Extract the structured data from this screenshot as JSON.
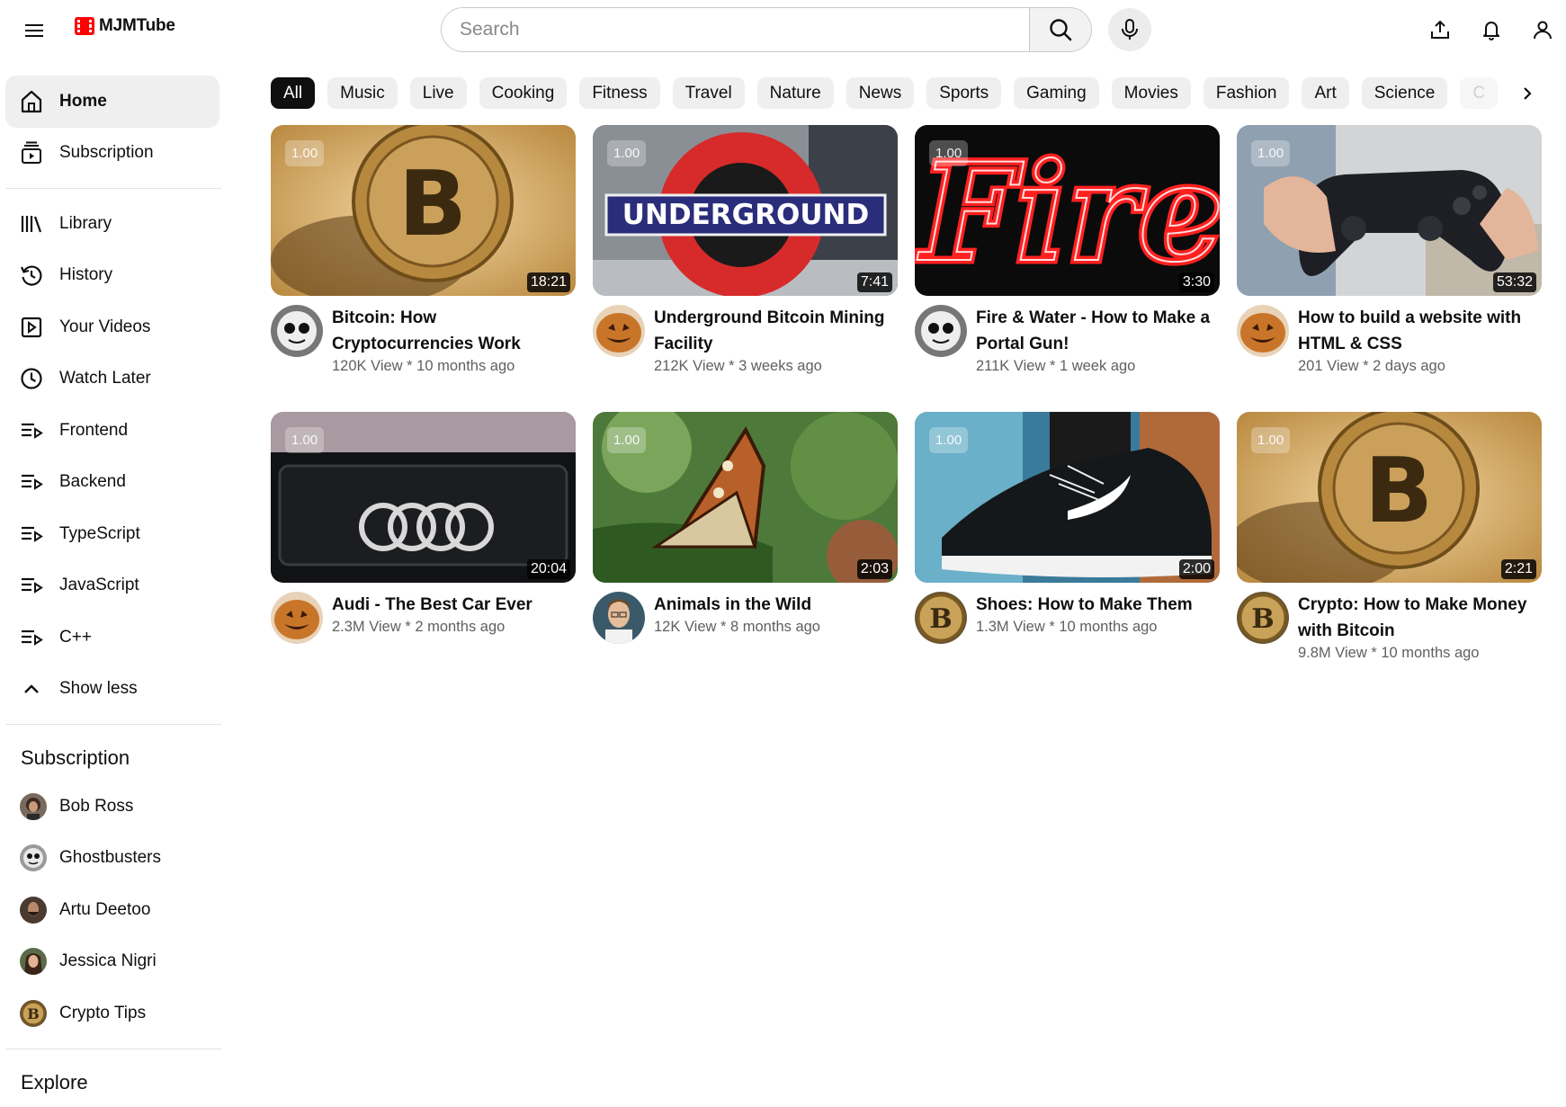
{
  "app": {
    "name": "MJMTube"
  },
  "header": {
    "search_placeholder": "Search",
    "icons": [
      "menu-icon",
      "search-icon",
      "mic-icon",
      "upload-icon",
      "bell-icon",
      "user-icon"
    ]
  },
  "sidebar": {
    "main": [
      {
        "label": "Home",
        "icon": "home-icon",
        "active": true
      },
      {
        "label": "Subscription",
        "icon": "subscription-icon"
      }
    ],
    "library": [
      {
        "label": "Library",
        "icon": "library-icon"
      },
      {
        "label": "History",
        "icon": "history-icon"
      },
      {
        "label": "Your Videos",
        "icon": "your-videos-icon"
      },
      {
        "label": "Watch Later",
        "icon": "watch-later-icon"
      },
      {
        "label": "Frontend",
        "icon": "playlist-icon"
      },
      {
        "label": "Backend",
        "icon": "playlist-icon"
      },
      {
        "label": "TypeScript",
        "icon": "playlist-icon"
      },
      {
        "label": "JavaScript",
        "icon": "playlist-icon"
      },
      {
        "label": "C++",
        "icon": "playlist-icon"
      },
      {
        "label": "Show less",
        "icon": "chevron-up-icon"
      }
    ],
    "subscription_heading": "Subscription",
    "subscriptions": [
      {
        "label": "Bob Ross"
      },
      {
        "label": "Ghostbusters"
      },
      {
        "label": "Artu Deetoo"
      },
      {
        "label": "Jessica Nigri"
      },
      {
        "label": "Crypto Tips"
      }
    ],
    "explore_heading": "Explore"
  },
  "chips": [
    "All",
    "Music",
    "Live",
    "Cooking",
    "Fitness",
    "Travel",
    "Nature",
    "News",
    "Sports",
    "Gaming",
    "Movies",
    "Fashion",
    "Art",
    "Science",
    "C"
  ],
  "videos": [
    {
      "title": "Bitcoin: How Cryptocurrencies Work",
      "stats": "120K View * 10 months ago",
      "duration": "18:21",
      "speed": "1.00",
      "thumb": "bitcoin",
      "avatar": "skull"
    },
    {
      "title": "Underground Bitcoin Mining Facility",
      "stats": "212K View * 3 weeks ago",
      "duration": "7:41",
      "speed": "1.00",
      "thumb": "underground",
      "avatar": "pumpkin"
    },
    {
      "title": "Fire & Water - How to Make a Portal Gun!",
      "stats": "211K View * 1 week ago",
      "duration": "3:30",
      "speed": "1.00",
      "thumb": "fire",
      "avatar": "skull"
    },
    {
      "title": "How to build a website with HTML & CSS",
      "stats": "201 View * 2 days ago",
      "duration": "53:32",
      "speed": "1.00",
      "thumb": "controller",
      "avatar": "pumpkin"
    },
    {
      "title": "Audi - The Best Car Ever",
      "stats": "2.3M View * 2 months ago",
      "duration": "20:04",
      "speed": "1.00",
      "thumb": "audi",
      "avatar": "pumpkin"
    },
    {
      "title": "Animals in the Wild",
      "stats": "12K View * 8 months ago",
      "duration": "2:03",
      "speed": "1.00",
      "thumb": "butterfly",
      "avatar": "person"
    },
    {
      "title": "Shoes: How to Make Them",
      "stats": "1.3M View * 10 months ago",
      "duration": "2:00",
      "speed": "1.00",
      "thumb": "shoe",
      "avatar": "coin"
    },
    {
      "title": "Crypto: How to Make Money with Bitcoin",
      "stats": "9.8M View * 10 months ago",
      "duration": "2:21",
      "speed": "1.00",
      "thumb": "bitcoin",
      "avatar": "coin"
    }
  ]
}
